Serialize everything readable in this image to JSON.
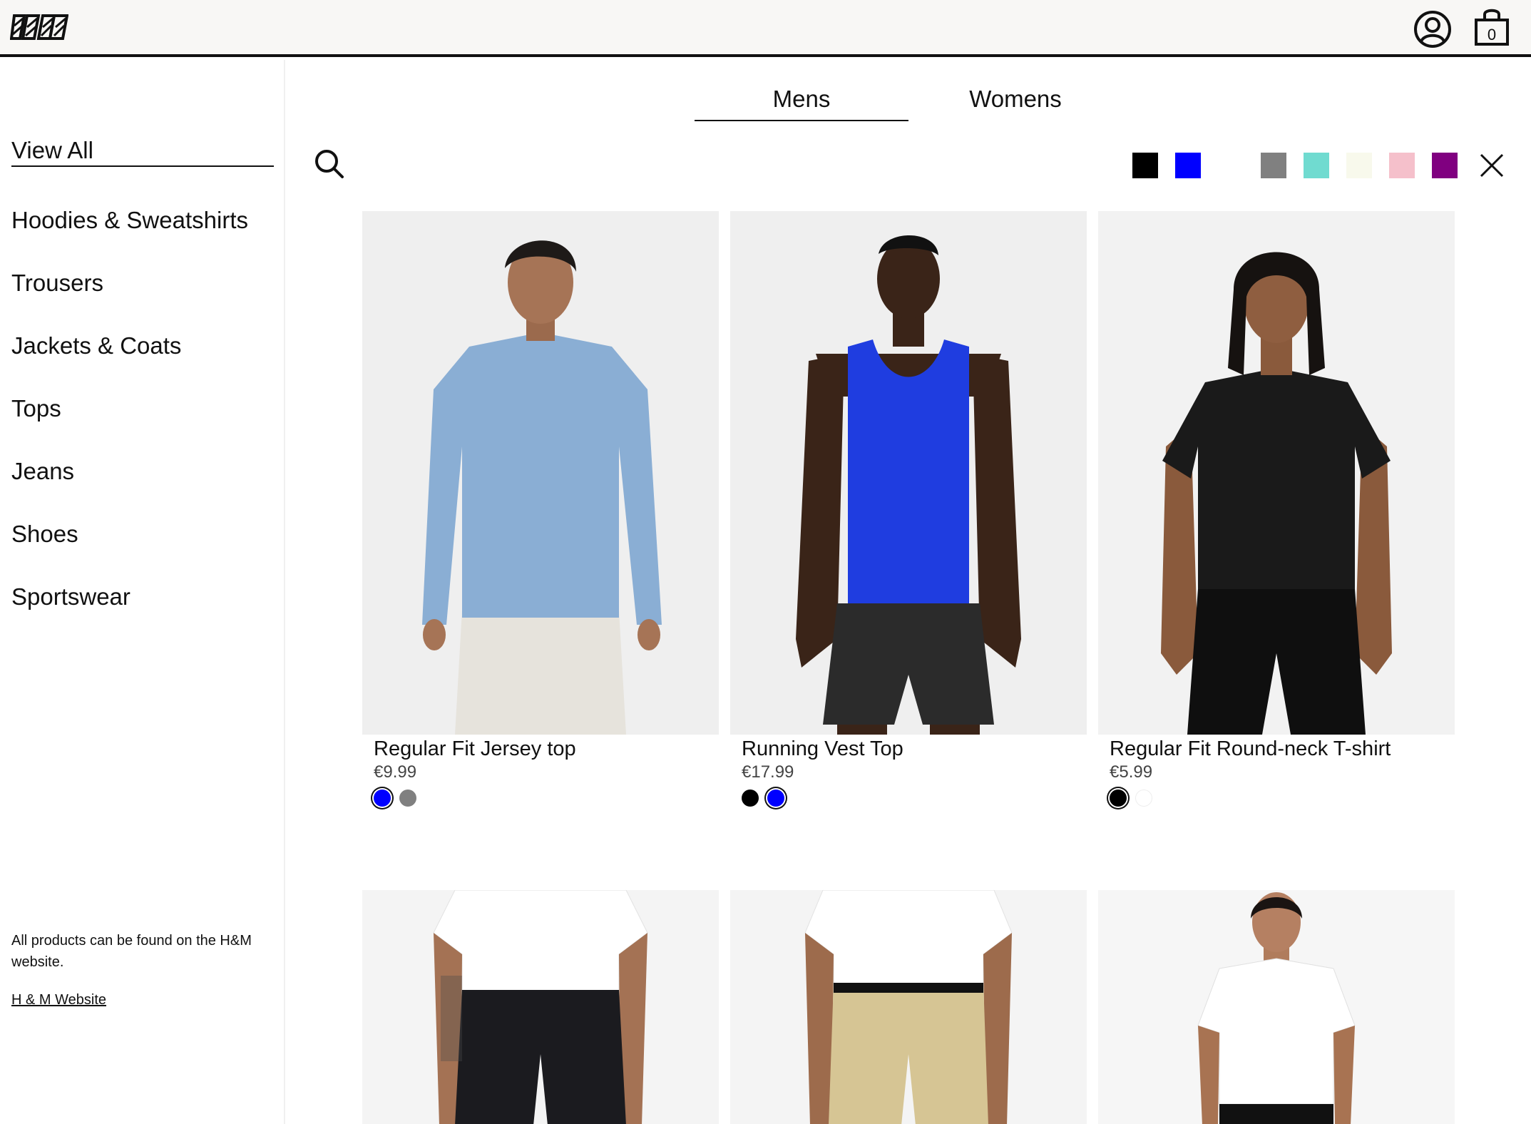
{
  "header": {
    "logo_name": "brand-logo",
    "bag_count": "0"
  },
  "sidebar": {
    "items": [
      {
        "label": "View All",
        "active": true
      },
      {
        "label": "Hoodies & Sweatshirts"
      },
      {
        "label": "Trousers"
      },
      {
        "label": "Jackets & Coats"
      },
      {
        "label": "Tops"
      },
      {
        "label": "Jeans"
      },
      {
        "label": "Shoes"
      },
      {
        "label": "Sportswear"
      }
    ],
    "footer_note": "All products can be found on the H&M website.",
    "footer_link": "H & M Website"
  },
  "tabs": [
    {
      "label": "Mens",
      "active": true
    },
    {
      "label": "Womens",
      "active": false
    }
  ],
  "color_filters": [
    {
      "name": "black",
      "color": "#000000"
    },
    {
      "name": "blue",
      "color": "#0000ff"
    },
    {
      "name": "white",
      "color": "#ffffff"
    },
    {
      "name": "grey",
      "color": "#808080"
    },
    {
      "name": "turquoise",
      "color": "#70dbd0"
    },
    {
      "name": "cream",
      "color": "#f8f9ec"
    },
    {
      "name": "pink",
      "color": "#f5c0cb"
    },
    {
      "name": "purple",
      "color": "#800080"
    }
  ],
  "products": [
    {
      "name": "Regular Fit Jersey top",
      "price": "€9.99",
      "variant_colors": [
        "#0000ff",
        "#808080"
      ],
      "selected_variant": 0,
      "garment": "long-sleeve-top"
    },
    {
      "name": "Running Vest Top",
      "price": "€17.99",
      "variant_colors": [
        "#000000",
        "#0000ff"
      ],
      "selected_variant": 1,
      "garment": "vest-top"
    },
    {
      "name": "Regular Fit Round-neck T-shirt",
      "price": "€5.99",
      "variant_colors": [
        "#000000",
        "#ffffff"
      ],
      "selected_variant": 0,
      "garment": "t-shirt"
    },
    {
      "garment": "jeans"
    },
    {
      "garment": "chinos"
    },
    {
      "garment": "white-t-shirt"
    }
  ]
}
